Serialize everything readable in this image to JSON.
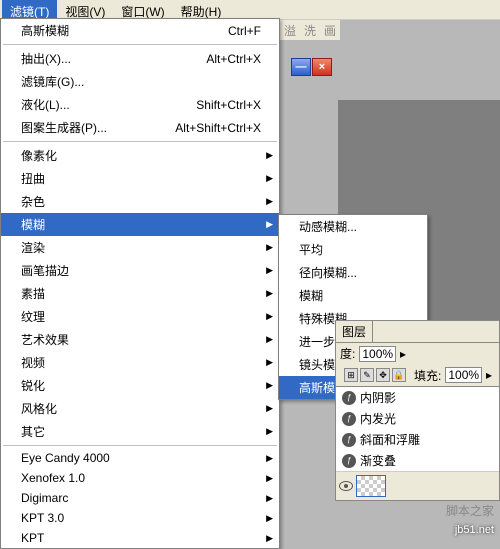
{
  "menubar": {
    "filter": "滤镜(T)",
    "view": "视图(V)",
    "window": "窗口(W)",
    "help": "帮助(H)"
  },
  "toolbar_frag": {
    "a": "溢",
    "b": "洗",
    "c": "画"
  },
  "wc": {
    "min": "—",
    "close": "×"
  },
  "dropdown": {
    "last": "高斯模糊",
    "last_sc": "Ctrl+F",
    "extract": "抽出(X)...",
    "extract_sc": "Alt+Ctrl+X",
    "gallery": "滤镜库(G)...",
    "liquify": "液化(L)...",
    "liquify_sc": "Shift+Ctrl+X",
    "pattern": "图案生成器(P)...",
    "pattern_sc": "Alt+Shift+Ctrl+X",
    "pixelate": "像素化",
    "distort": "扭曲",
    "noise": "杂色",
    "blur": "模糊",
    "render": "渲染",
    "brush": "画笔描边",
    "sketch": "素描",
    "texture": "纹理",
    "artistic": "艺术效果",
    "video": "视频",
    "sharpen": "锐化",
    "stylize": "风格化",
    "other": "其它",
    "eye": "Eye Candy 4000",
    "xeno": "Xenofex 1.0",
    "digi": "Digimarc",
    "kpt3": "KPT 3.0",
    "kpt": "KPT"
  },
  "submenu": {
    "motion": "动感模糊...",
    "average": "平均",
    "radial": "径向模糊...",
    "blur": "模糊",
    "special": "特殊模糊...",
    "more": "进一步模糊",
    "lens": "镜头模糊...",
    "gaussian": "高斯模糊..."
  },
  "layers": {
    "tab": "图层",
    "opacity_label": "度:",
    "fill_label": "填充:",
    "percent": "100%",
    "fx_inner_shadow": "内阴影",
    "fx_inner_glow": "内发光",
    "fx_bevel": "斜面和浮雕",
    "fx_grad": "渐变叠"
  },
  "watermark": {
    "site": "jb51.net",
    "text": "脚本之家"
  }
}
